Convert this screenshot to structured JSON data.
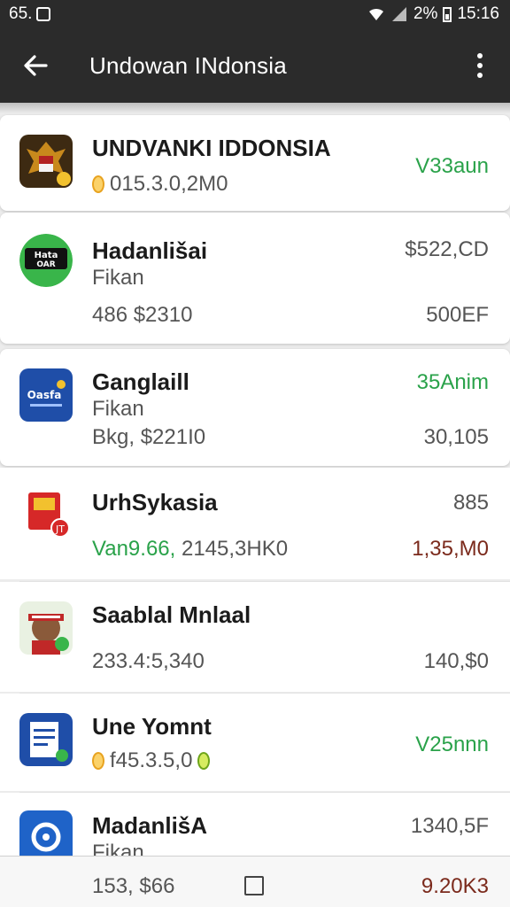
{
  "status_bar": {
    "left_text": "65.",
    "battery_pct": "2%",
    "time": "15:16"
  },
  "app_bar": {
    "title": "Undowan INdonsia"
  },
  "items": [
    {
      "name": "UNDVANKI IDDONSIA",
      "meta": "015.3.0,2M0",
      "right_top": "V33aun",
      "icon": "garuda-emblem-icon"
    },
    {
      "name": "Hadanlišai",
      "sub": "Fikan",
      "meta": "486 $2310",
      "right_top": "$522,CD",
      "right_bottom": "500EF",
      "icon": "green-badge-icon"
    },
    {
      "name": "Ganglaill",
      "sub": "Fikan",
      "meta": "Bkg, $221I0",
      "right_top": "35Anim",
      "right_bottom": "30,105",
      "icon": "blue-logo-icon"
    },
    {
      "name": "UrhSykasia",
      "meta_green": "Van9.66,",
      "meta": "2145,3HK0",
      "right_top": "885",
      "right_bottom": "1,35,M0",
      "icon": "red-package-icon"
    },
    {
      "name": "Saablal Mnlaal",
      "meta": "233.4:5,340",
      "right_bottom": "140,$0",
      "icon": "avatar-icon"
    },
    {
      "name": "Une Yomnt",
      "meta": "f45.3.5,0",
      "right_top": "V25nnn",
      "icon": "document-icon"
    },
    {
      "name": "MadanlišA",
      "sub": "Fikan",
      "right_top": "1340,5F",
      "icon": "location-pin-icon"
    }
  ],
  "bottom_bar": {
    "left_value": "153, $66",
    "right_value": "9.20K3"
  },
  "colors": {
    "appbar_bg": "#2b2b2b",
    "green_text": "#2aa24a",
    "dark_red_text": "#7b2a1c"
  }
}
